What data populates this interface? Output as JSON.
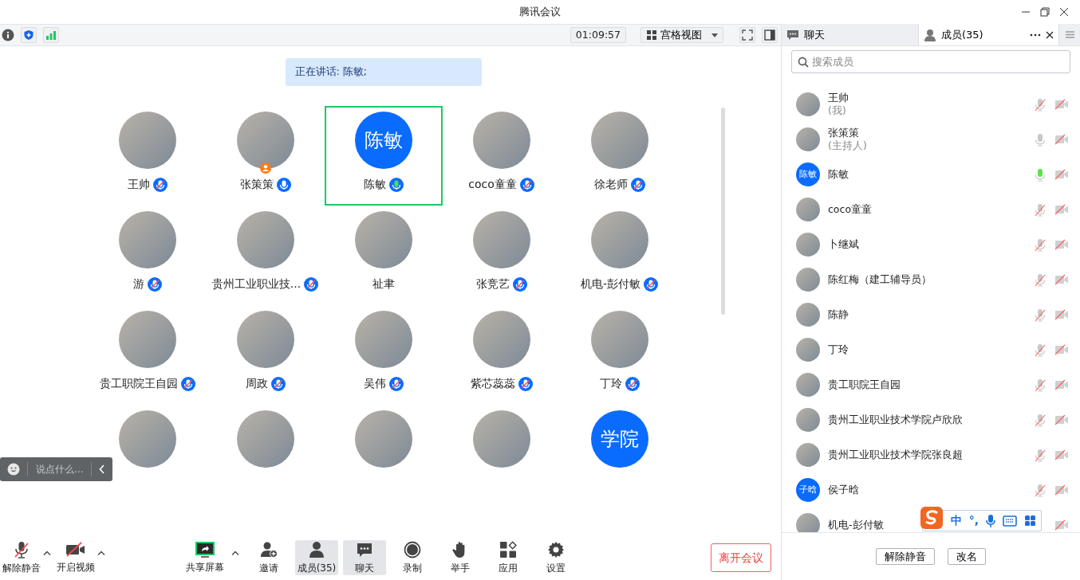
{
  "window": {
    "title": "腾讯会议"
  },
  "toolbar": {
    "timer": "01:09:57",
    "view_menu": "宫格视图"
  },
  "speaker_banner": "正在讲话: 陈敏;",
  "tiles": [
    {
      "name": "王帅",
      "mic": {
        "muted": true,
        "speaking": false
      },
      "host": false,
      "selected": false
    },
    {
      "name": "张策策",
      "mic": {
        "muted": false,
        "speaking": false
      },
      "host": true,
      "selected": false
    },
    {
      "name": "陈敏",
      "avatar_text": "陈敏",
      "mic": {
        "muted": false,
        "speaking": true
      },
      "host": false,
      "selected": true
    },
    {
      "name": "coco童童",
      "mic": {
        "muted": true,
        "speaking": false
      },
      "host": false,
      "selected": false
    },
    {
      "name": "徐老师",
      "mic": {
        "muted": true,
        "speaking": false
      },
      "host": false,
      "selected": false
    },
    {
      "name": "游",
      "mic": {
        "muted": true,
        "speaking": false
      },
      "host": false,
      "selected": false
    },
    {
      "name": "贵州工业职业技...",
      "mic": {
        "muted": true,
        "speaking": false
      },
      "host": false,
      "selected": false
    },
    {
      "name": "祉聿",
      "host": false,
      "selected": false
    },
    {
      "name": "张竞艺",
      "mic": {
        "muted": true,
        "speaking": false
      },
      "host": false,
      "selected": false
    },
    {
      "name": "机电-彭付敏",
      "mic": {
        "muted": true,
        "speaking": false
      },
      "host": false,
      "selected": false
    },
    {
      "name": "贵工职院王自园",
      "mic": {
        "muted": true,
        "speaking": false
      },
      "host": false,
      "selected": false
    },
    {
      "name": "周政",
      "mic": {
        "muted": true,
        "speaking": false
      },
      "host": false,
      "selected": false
    },
    {
      "name": "吴伟",
      "mic": {
        "muted": true,
        "speaking": false
      },
      "host": false,
      "selected": false
    },
    {
      "name": "紫芯蕊蕊",
      "mic": {
        "muted": true,
        "speaking": false
      },
      "host": false,
      "selected": false
    },
    {
      "name": "丁玲",
      "mic": {
        "muted": true,
        "speaking": false
      },
      "host": false,
      "selected": false
    },
    {
      "host": false,
      "selected": false
    },
    {
      "host": false,
      "selected": false
    },
    {
      "host": false,
      "selected": false
    },
    {
      "host": false,
      "selected": false
    },
    {
      "avatar_text": "学院",
      "host": false,
      "selected": false
    }
  ],
  "chat_input": {
    "placeholder": "说点什么..."
  },
  "side_tabs": [
    {
      "label": "聊天",
      "kind": "chat",
      "selected": false
    },
    {
      "label": "成员(35)",
      "kind": "members",
      "selected": true
    }
  ],
  "member_search": {
    "placeholder": "搜索成员"
  },
  "members": [
    {
      "name": "王帅",
      "note": "(我)",
      "mic": {
        "muted": true,
        "speaking": false
      },
      "video_on": false
    },
    {
      "name": "张策策",
      "note": "(主持人)",
      "mic": {
        "muted": false,
        "speaking": false
      },
      "video_on": false
    },
    {
      "name": "陈敏",
      "avatar_text": "陈敏",
      "mic": {
        "muted": false,
        "speaking": true
      },
      "video_on": false
    },
    {
      "name": "coco童童",
      "mic": {
        "muted": true,
        "speaking": false
      },
      "video_on": false
    },
    {
      "name": "卜继斌",
      "mic": {
        "muted": true,
        "speaking": false
      },
      "video_on": false
    },
    {
      "name": "陈红梅（建工辅导员）",
      "mic": {
        "muted": true,
        "speaking": false
      },
      "video_on": false
    },
    {
      "name": "陈静",
      "mic": {
        "muted": true,
        "speaking": false
      },
      "video_on": false
    },
    {
      "name": "丁玲",
      "mic": {
        "muted": true,
        "speaking": false
      },
      "video_on": false
    },
    {
      "name": "贵工职院王自园",
      "mic": {
        "muted": true,
        "speaking": false
      },
      "video_on": false
    },
    {
      "name": "贵州工业职业技术学院卢欣欣",
      "mic": {
        "muted": true,
        "speaking": false
      },
      "video_on": false
    },
    {
      "name": "贵州工业职业技术学院张良超",
      "mic": {
        "muted": true,
        "speaking": false
      },
      "video_on": false
    },
    {
      "name": "侯子晗",
      "avatar_text": "子晗",
      "mic": {
        "muted": true,
        "speaking": false
      },
      "video_on": false
    },
    {
      "name": "机电-彭付敏",
      "video_on": false
    }
  ],
  "ime_toolbar": {
    "mode": "中",
    "punct": "°,"
  },
  "member_buttons": [
    "解除静音",
    "改名"
  ],
  "controls": [
    {
      "label": "解除静音",
      "kind": "mic-off",
      "caret": true,
      "active": false
    },
    {
      "label": "开启视频",
      "kind": "video-off",
      "caret": true,
      "active": false
    },
    {
      "label": "共享屏幕",
      "kind": "share",
      "caret": true,
      "active": false
    },
    {
      "label": "邀请",
      "kind": "invite",
      "caret": false,
      "active": false
    },
    {
      "label": "成员(35)",
      "kind": "members",
      "caret": false,
      "active": true
    },
    {
      "label": "聊天",
      "kind": "chat",
      "caret": false,
      "active": true
    },
    {
      "label": "录制",
      "kind": "record",
      "caret": false,
      "active": false
    },
    {
      "label": "举手",
      "kind": "hand",
      "caret": false,
      "active": false
    },
    {
      "label": "应用",
      "kind": "apps",
      "caret": false,
      "active": false
    },
    {
      "label": "设置",
      "kind": "settings",
      "caret": false,
      "active": false
    }
  ],
  "leave_button": "离开会议"
}
